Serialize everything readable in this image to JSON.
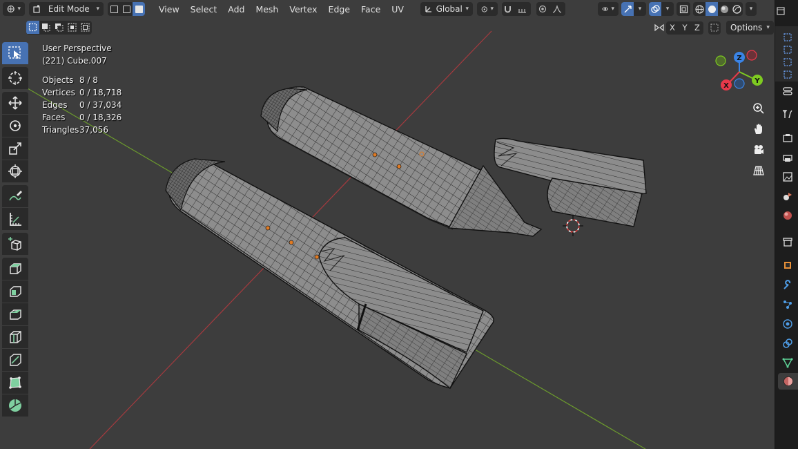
{
  "header": {
    "editor_type_icon": "globe-grid-icon",
    "mode": {
      "label": "Edit Mode",
      "icon": "edit-mode-icon"
    },
    "select_modes": [
      "vertex",
      "edge",
      "face"
    ],
    "active_select_mode": "face",
    "menus": [
      "View",
      "Select",
      "Add",
      "Mesh",
      "Vertex",
      "Edge",
      "Face",
      "UV"
    ],
    "transform_orientation": "Global",
    "pivot_icon": "pivot-icon",
    "snap_icon": "magnet-icon",
    "proportional_icon": "proportional-icon",
    "right_icons": [
      "visibility-icon",
      "gizmo-icon",
      "overlay-icon",
      "xray-icon",
      "wireframe-shading-icon",
      "solid-shading-icon",
      "material-shading-icon",
      "rendered-shading-icon"
    ]
  },
  "subheader": {
    "select_box_modes": [
      "new",
      "extend",
      "subtract",
      "invert",
      "intersect"
    ],
    "mirror_icon": "mirror-icon",
    "axes": [
      "X",
      "Y",
      "Z"
    ],
    "options_label": "Options"
  },
  "overlay": {
    "view_name": "User Perspective",
    "object_name": "(221) Cube.007",
    "stats": [
      {
        "key": "Objects",
        "value": "8 / 8"
      },
      {
        "key": "Vertices",
        "value": "0 / 18,718"
      },
      {
        "key": "Edges",
        "value": "0 / 37,034"
      },
      {
        "key": "Faces",
        "value": "0 / 18,326"
      },
      {
        "key": "Triangles",
        "value": "37,056"
      }
    ]
  },
  "gizmo": {
    "x": "X",
    "y": "Y",
    "z": "Z"
  },
  "toolbar": [
    "select-box",
    "cursor",
    "move",
    "rotate",
    "scale",
    "transform",
    "annotate",
    "measure",
    "add-cube",
    "extrude",
    "inset",
    "bevel",
    "loop-cut",
    "knife",
    "poly-build",
    "spin"
  ],
  "colors": {
    "accent": "#4772b3",
    "viewport_bg": "#3d3d3d",
    "axis_x": "#a63a3e",
    "axis_y": "#6c9b2d",
    "gizmo_x": "#e8394a",
    "gizmo_y": "#7ecb21",
    "gizmo_z": "#3a84e6"
  }
}
